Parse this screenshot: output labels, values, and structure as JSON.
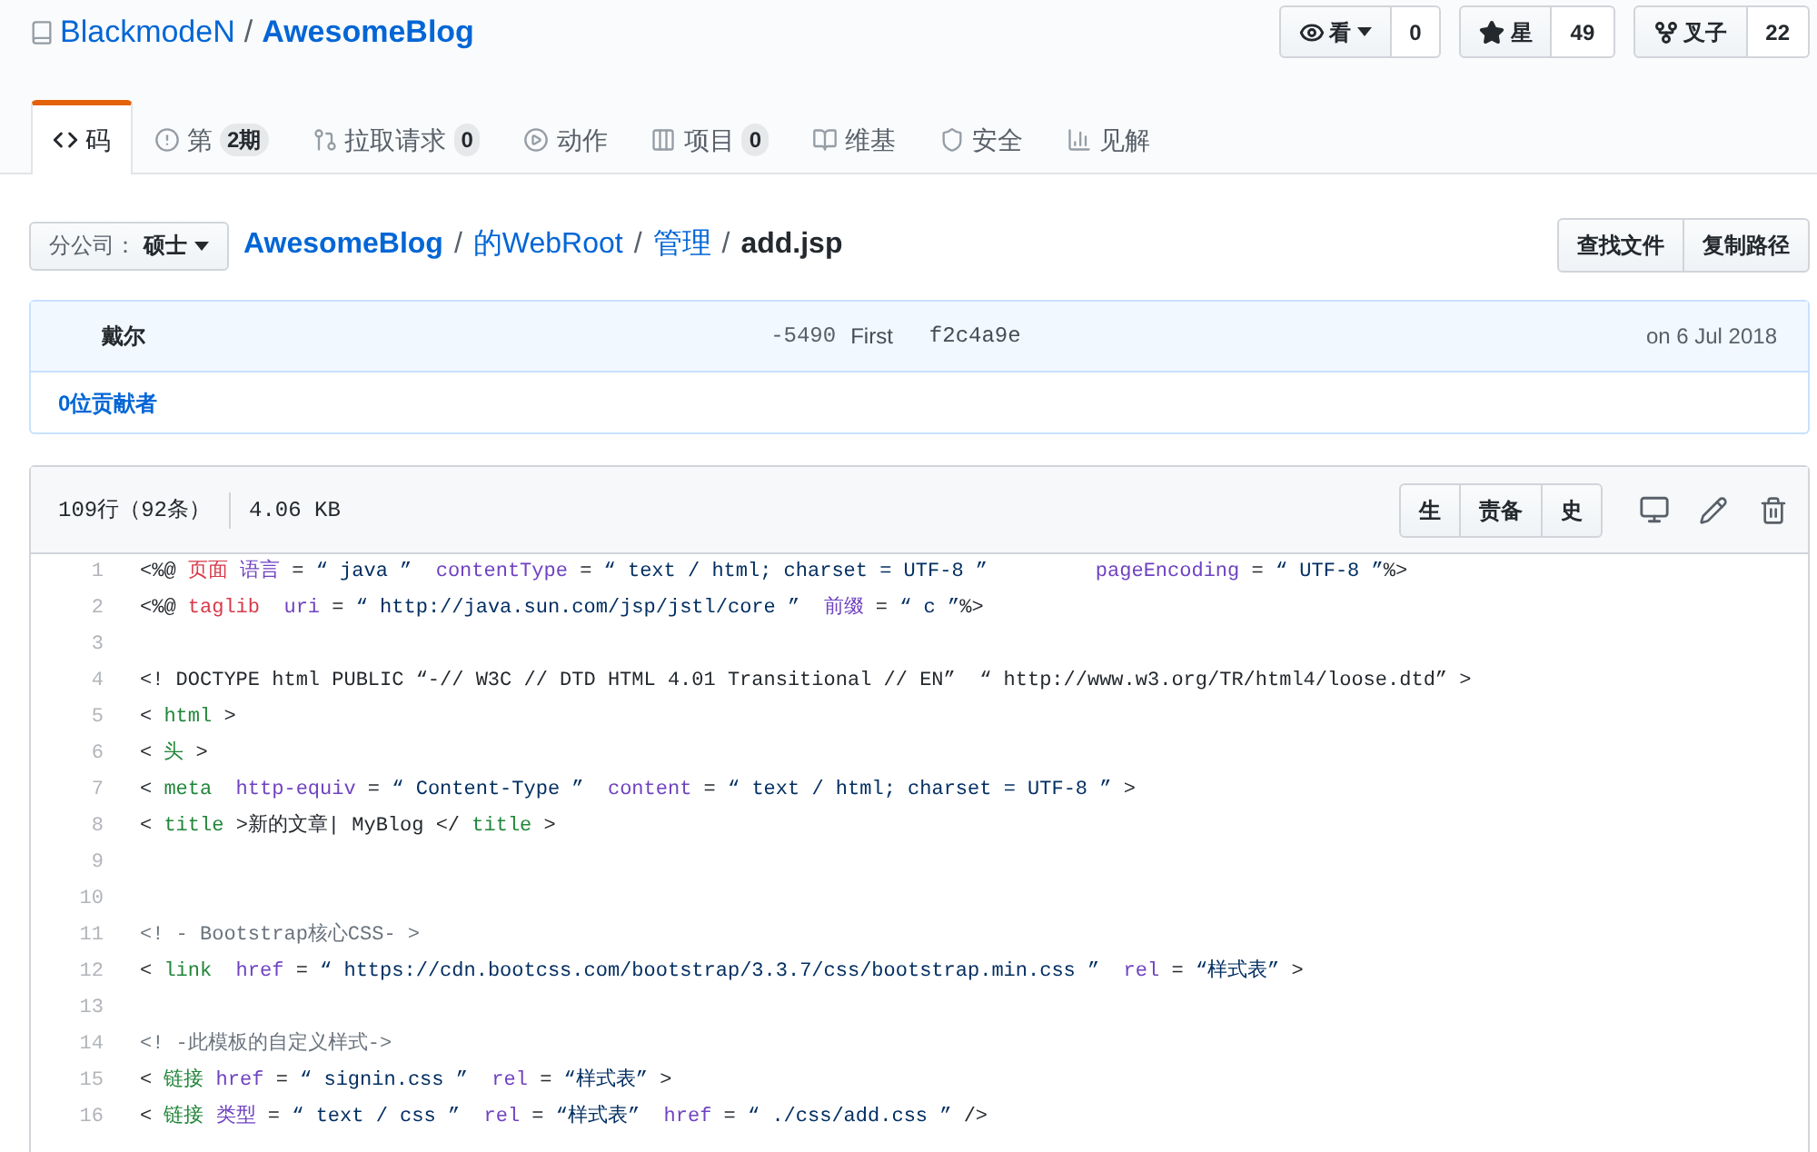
{
  "repo": {
    "owner": "BlackmodeN",
    "separator": "/",
    "name": "AwesomeBlog"
  },
  "repo_actions": [
    {
      "kind": "watch",
      "label": "看",
      "count": "0"
    },
    {
      "kind": "star",
      "label": "星",
      "count": "49"
    },
    {
      "kind": "fork",
      "label": "叉子",
      "count": "22"
    }
  ],
  "tabs": [
    {
      "kind": "code",
      "label": "码",
      "selected": true
    },
    {
      "kind": "issues",
      "label": "第",
      "counter": "2期",
      "selected": false
    },
    {
      "kind": "pulls",
      "label": "拉取请求",
      "counter": "0",
      "selected": false
    },
    {
      "kind": "actions",
      "label": "动作",
      "selected": false
    },
    {
      "kind": "projects",
      "label": "项目",
      "counter": "0",
      "selected": false
    },
    {
      "kind": "wiki",
      "label": "维基",
      "selected": false
    },
    {
      "kind": "security",
      "label": "安全",
      "selected": false
    },
    {
      "kind": "insights",
      "label": "见解",
      "selected": false
    }
  ],
  "branch": {
    "prefix": "分公司：",
    "name": "硕士"
  },
  "breadcrumb": [
    {
      "kind": "root",
      "label": "AwesomeBlog"
    },
    {
      "kind": "dir",
      "separator": "/",
      "label": "的WebRoot"
    },
    {
      "kind": "dir",
      "separator": "/",
      "label": "管理"
    },
    {
      "kind": "file",
      "separator": "/",
      "label": "add.jsp"
    }
  ],
  "file_actions": [
    "查找文件",
    "复制路径"
  ],
  "commit": {
    "author": "戴尔",
    "id": "-5490",
    "message": "First",
    "sha": "f2c4a9e",
    "date": "on 6 Jul 2018",
    "contributors": "0位贡献者"
  },
  "file": {
    "line_info": "109行（92条）",
    "size": "4.06 KB",
    "view_buttons": [
      "生",
      "责备",
      "史"
    ],
    "lines": [
      {
        "number": "1",
        "tokens": [
          {
            "kind": "plain",
            "text": "<%@ "
          },
          {
            "kind": "keyword",
            "text": "页面"
          },
          {
            "kind": "attr",
            "text": " 语言"
          },
          {
            "kind": "plain",
            "text": " = "
          },
          {
            "kind": "string",
            "text": "“ java ”"
          },
          {
            "kind": "attr",
            "text": "  contentType"
          },
          {
            "kind": "plain",
            "text": " = "
          },
          {
            "kind": "string",
            "text": "“ text / html; charset = UTF-8 ”"
          },
          {
            "kind": "attr",
            "text": "         pageEncoding"
          },
          {
            "kind": "plain",
            "text": " = "
          },
          {
            "kind": "string",
            "text": "“ UTF-8 ”"
          },
          {
            "kind": "plain",
            "text": "%>"
          }
        ]
      },
      {
        "number": "2",
        "tokens": [
          {
            "kind": "plain",
            "text": "<%@ "
          },
          {
            "kind": "keyword",
            "text": "taglib"
          },
          {
            "kind": "attr",
            "text": "  uri"
          },
          {
            "kind": "plain",
            "text": " = "
          },
          {
            "kind": "string",
            "text": "“ http://java.sun.com/jsp/jstl/core ”"
          },
          {
            "kind": "attr",
            "text": "  前缀"
          },
          {
            "kind": "plain",
            "text": " = "
          },
          {
            "kind": "string",
            "text": "“ c ”"
          },
          {
            "kind": "plain",
            "text": "%>"
          }
        ]
      },
      {
        "number": "3"
      },
      {
        "number": "4",
        "tokens": [
          {
            "kind": "plain",
            "text": "<! DOCTYPE html PUBLIC “-// W3C // DTD HTML 4.01 Transitional // EN”  “ http://www.w3.org/TR/html4/loose.dtd” >"
          }
        ]
      },
      {
        "number": "5",
        "tokens": [
          {
            "kind": "plain",
            "text": "< "
          },
          {
            "kind": "tag",
            "text": "html"
          },
          {
            "kind": "plain",
            "text": " >"
          }
        ]
      },
      {
        "number": "6",
        "tokens": [
          {
            "kind": "plain",
            "text": "< "
          },
          {
            "kind": "tag",
            "text": "头"
          },
          {
            "kind": "plain",
            "text": " >"
          }
        ]
      },
      {
        "number": "7",
        "tokens": [
          {
            "kind": "plain",
            "text": "< "
          },
          {
            "kind": "tag",
            "text": "meta"
          },
          {
            "kind": "attr",
            "text": "  http-equiv"
          },
          {
            "kind": "plain",
            "text": " = "
          },
          {
            "kind": "string",
            "text": "“ Content-Type ”"
          },
          {
            "kind": "attr",
            "text": "  content"
          },
          {
            "kind": "plain",
            "text": " = "
          },
          {
            "kind": "string",
            "text": "“ text / html; charset = UTF-8 ”"
          },
          {
            "kind": "plain",
            "text": " >"
          }
        ]
      },
      {
        "number": "8",
        "tokens": [
          {
            "kind": "plain",
            "text": "< "
          },
          {
            "kind": "tag",
            "text": "title"
          },
          {
            "kind": "plain",
            "text": " >新的文章| MyBlog </ "
          },
          {
            "kind": "tag",
            "text": "title"
          },
          {
            "kind": "plain",
            "text": " >"
          }
        ]
      },
      {
        "number": "9"
      },
      {
        "number": "10"
      },
      {
        "number": "11",
        "tokens": [
          {
            "kind": "comment",
            "text": "<! - Bootstrap核心CSS- >"
          }
        ]
      },
      {
        "number": "12",
        "tokens": [
          {
            "kind": "plain",
            "text": "< "
          },
          {
            "kind": "tag",
            "text": "link"
          },
          {
            "kind": "attr",
            "text": "  href"
          },
          {
            "kind": "plain",
            "text": " = "
          },
          {
            "kind": "string",
            "text": "“ https://cdn.bootcss.com/bootstrap/3.3.7/css/bootstrap.min.css ”"
          },
          {
            "kind": "attr",
            "text": "  rel"
          },
          {
            "kind": "plain",
            "text": " = "
          },
          {
            "kind": "string",
            "text": "“样式表”"
          },
          {
            "kind": "plain",
            "text": " >"
          }
        ]
      },
      {
        "number": "13"
      },
      {
        "number": "14",
        "tokens": [
          {
            "kind": "comment",
            "text": "<! -此模板的自定义样式->"
          }
        ]
      },
      {
        "number": "15",
        "tokens": [
          {
            "kind": "plain",
            "text": "< "
          },
          {
            "kind": "tag",
            "text": "链接"
          },
          {
            "kind": "attr",
            "text": " href"
          },
          {
            "kind": "plain",
            "text": " = "
          },
          {
            "kind": "string",
            "text": "“ signin.css ”"
          },
          {
            "kind": "attr",
            "text": "  rel"
          },
          {
            "kind": "plain",
            "text": " = "
          },
          {
            "kind": "string",
            "text": "“样式表”"
          },
          {
            "kind": "plain",
            "text": " >"
          }
        ]
      },
      {
        "number": "16",
        "tokens": [
          {
            "kind": "plain",
            "text": "< "
          },
          {
            "kind": "tag",
            "text": "链接"
          },
          {
            "kind": "attr",
            "text": " 类型"
          },
          {
            "kind": "plain",
            "text": " = "
          },
          {
            "kind": "string",
            "text": "“ text / css ”"
          },
          {
            "kind": "attr",
            "text": "  rel"
          },
          {
            "kind": "plain",
            "text": " = "
          },
          {
            "kind": "string",
            "text": "“样式表”"
          },
          {
            "kind": "attr",
            "text": "  href"
          },
          {
            "kind": "plain",
            "text": " = "
          },
          {
            "kind": "string",
            "text": "“ ./css/add.css ”"
          },
          {
            "kind": "plain",
            "text": " />"
          }
        ]
      }
    ]
  }
}
